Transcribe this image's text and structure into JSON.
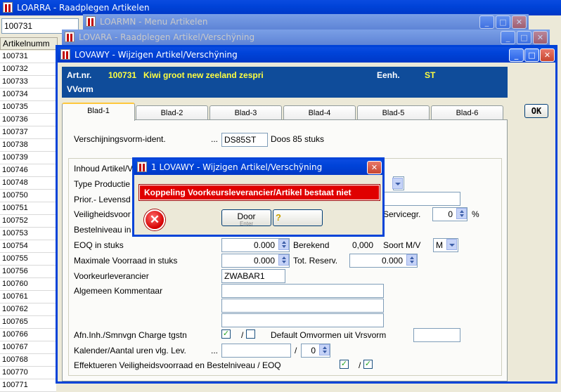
{
  "bg_window": {
    "title": "LOARRA - Raadplegen Artikelen",
    "search_value": "100731",
    "column_header": "Artikelnumm",
    "rows": [
      "100731",
      "100732",
      "100733",
      "100734",
      "100735",
      "100736",
      "100737",
      "100738",
      "100739",
      "100746",
      "100748",
      "100750",
      "100751",
      "100752",
      "100753",
      "100754",
      "100755",
      "100756",
      "100760",
      "100761",
      "100762",
      "100765",
      "100766",
      "100767",
      "100768",
      "100770",
      "100771"
    ]
  },
  "win_menu": {
    "title": "LOARMN - Menu Artikelen"
  },
  "win_consult": {
    "title": "LOVARA - Raadplegen Artikel/Verschÿning"
  },
  "main": {
    "title": "LOVAWY - Wijzigen Artikel/Verschÿning",
    "header": {
      "artnr_label": "Art.nr.",
      "artnr_value": "100731",
      "artnr_desc": "Kiwi groot new zeeland zespri",
      "unit_label": "Eenh.",
      "unit_value": "ST",
      "vvorm_label": "VVorm"
    },
    "ok_label": "OK",
    "tabs": [
      "Blad-1",
      "Blad-2",
      "Blad-3",
      "Blad-4",
      "Blad-5",
      "Blad-6"
    ],
    "form": {
      "vv_ident_label": "Verschijningsvorm-ident.",
      "vv_ident_dots": "...",
      "vv_ident_value": "DS85ST",
      "vv_ident_desc": "Doos 85 stuks",
      "inhoud_label": "Inhoud Artikel/V",
      "type_label": "Type Productie",
      "prior_label": "Prior.- Levensd",
      "veilig_label": "Veiligheidsvoor",
      "servicegr_label": "Servicegr.",
      "servicegr_value": "0",
      "percent": "%",
      "bestel_label": "Bestelniveau in",
      "eoq_label": "EOQ in stuks",
      "eoq_value": "0.000",
      "berekend_label": "Berekend",
      "berekend_value": "0,000",
      "soort_label": "Soort M/V",
      "soort_value": "M",
      "max_label": "Maximale Voorraad in stuks",
      "max_value": "0.000",
      "totres_label": "Tot. Reserv.",
      "totres_value": "0.000",
      "voorkeur_label": "Voorkeurleverancier",
      "voorkeur_value": "ZWABAR1",
      "komm_label": "Algemeen Kommentaar",
      "afn_label": "Afn.Inh./Smnvgn Charge tgstn",
      "afn_sep": "/",
      "default_label": "Default Omvormen uit Vrsvorm",
      "kal_label": "Kalender/Aantal uren vlg. Lev.",
      "kal_dots": "...",
      "kal_sep": "/",
      "kal_value": "0",
      "eff_label": "Effektueren Veiligheidsvoorraad en Bestelniveau / EOQ",
      "eff_sep": "/"
    }
  },
  "dialog": {
    "title": "1 LOVAWY - Wijzigen Artikel/Verschÿning",
    "message": "Koppeling Voorkeursleverancier/Artikel bestaat niet",
    "door_label": "Door",
    "door_sub": "Enter",
    "help_icon": "?"
  },
  "colors": {
    "titlebar": "#0043d8",
    "header_band": "#0f4c9a",
    "header_yellow": "#ffff40",
    "error_red": "#e00000"
  }
}
